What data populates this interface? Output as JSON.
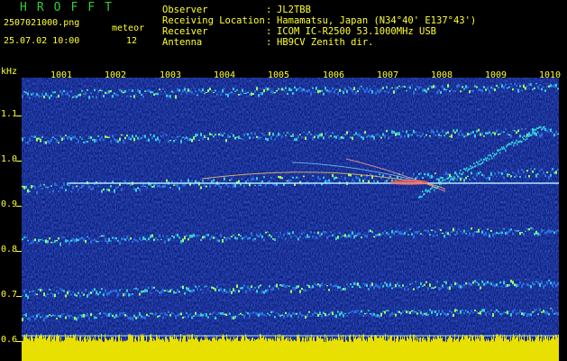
{
  "header": {
    "title": "HROFFT",
    "filename": "2507021000.png",
    "datetime": "25.07.02 10:00",
    "meteor_label": "meteor",
    "meteor_count": "12",
    "info": [
      {
        "label": "Observer",
        "value": "JL2TBB"
      },
      {
        "label": "Receiving Location",
        "value": "Hamamatsu, Japan (N34°40' E137°43')"
      },
      {
        "label": "Receiver",
        "value": "ICOM IC-R2500 53.1000MHz USB"
      },
      {
        "label": "Antenna",
        "value": "HB9CV Zenith dir."
      }
    ]
  },
  "axes": {
    "y_unit": "kHz",
    "y_ticks": [
      "1.1",
      "1.0",
      "0.9",
      "0.8",
      "0.7",
      "0.6"
    ],
    "x_ticks": [
      "1001",
      "1002",
      "1003",
      "1004",
      "1005",
      "1006",
      "1007",
      "1008",
      "1009",
      "1010"
    ]
  },
  "colors": {
    "background": "#000000",
    "text": "#ffff33",
    "title": "#33cc33",
    "spectrum_bg": "#0a1a6e"
  }
}
